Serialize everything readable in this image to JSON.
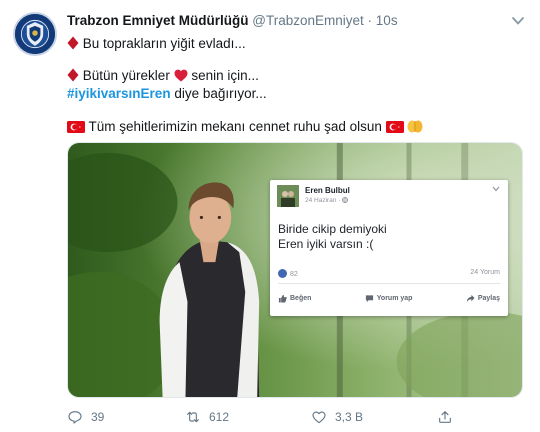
{
  "tweet": {
    "author_name": "Trabzon Emniyet Müdürlüğü",
    "handle": "@TrabzonEmniyet",
    "separator": "·",
    "time": "10s",
    "lines": {
      "line1": "Bu toprakların yiğit evladı...",
      "line2_pre": "Bütün yürekler",
      "line2_post": " senin için...",
      "hashtag": "#iyikivarsınEren",
      "line3_post": " diye bağırıyor...",
      "line4": "Tüm şehitlerimizin mekanı cennet ruhu şad olsun "
    },
    "avatar_text": "Polis"
  },
  "embedded_post": {
    "name": "Eren Bulbul",
    "date": "24 Haziran · ",
    "text_line1": "Biride cikip demiyoki",
    "text_line2": "Eren iyiki varsın :(",
    "likes": "82",
    "comments": "24 Yorum",
    "like_label": "Beğen",
    "comment_label": "Yorum yap",
    "share_label": "Paylaş"
  },
  "actions": {
    "reply_count": "39",
    "retweet_count": "612",
    "like_count": "3,3 B"
  },
  "colors": {
    "accent": "#1b95e0",
    "muted": "#657786",
    "flag_red": "#e30a17",
    "diamond_red": "#c0182a",
    "heart_red": "#e0245e",
    "fb_blue": "#4267b2"
  },
  "icons": [
    "avatar-badge",
    "caret-down-icon",
    "red-diamond-icon",
    "heart-icon",
    "turkish-flag-icon",
    "yellow-hands-icon",
    "reply-icon",
    "retweet-icon",
    "like-icon",
    "share-icon"
  ]
}
